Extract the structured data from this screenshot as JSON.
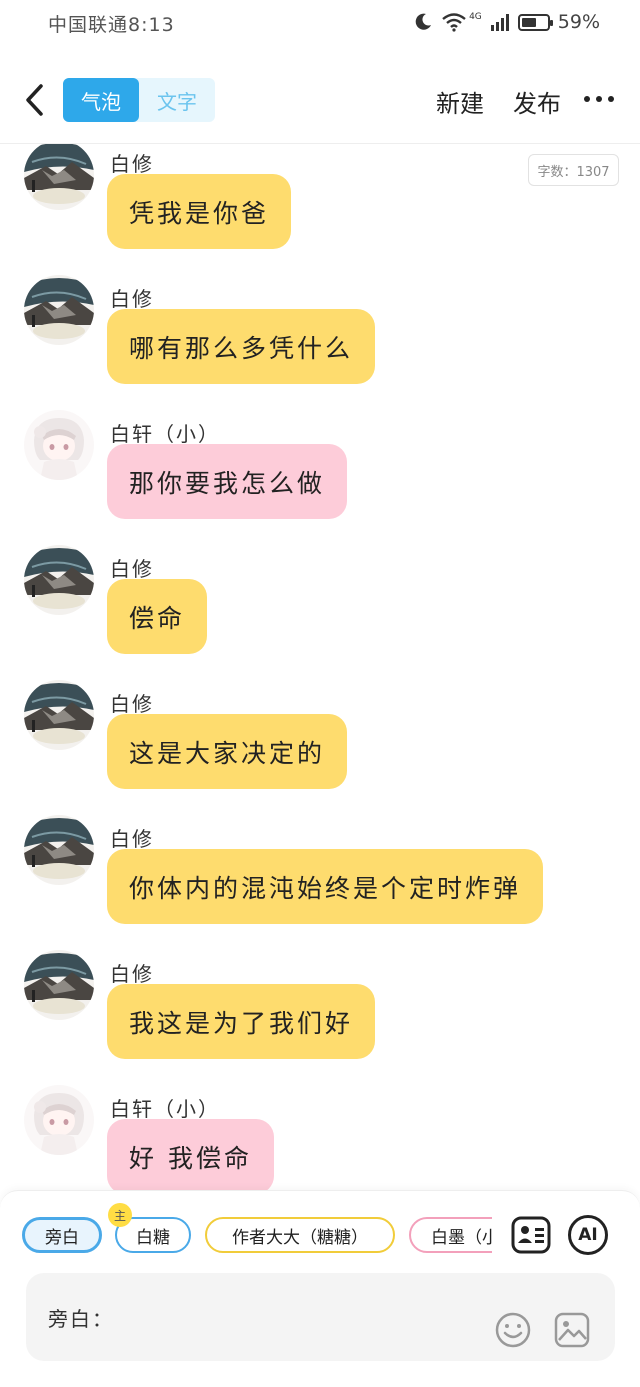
{
  "status_bar": {
    "carrier_time": "中国联通8:13",
    "battery": "59%",
    "battery_level": 0.59,
    "network": "4G"
  },
  "header": {
    "tabs": [
      {
        "label": "气泡",
        "active": true
      },
      {
        "label": "文字",
        "active": false
      }
    ],
    "new_label": "新建",
    "publish_label": "发布"
  },
  "chat": {
    "word_count": "字数：1307",
    "messages": [
      {
        "sender": "白修",
        "text": "凭我是你爸",
        "color": "yellow",
        "avatar": "landscape-avatar"
      },
      {
        "sender": "白修",
        "text": "哪有那么多凭什么",
        "color": "yellow",
        "avatar": "landscape-avatar"
      },
      {
        "sender": "白轩（小）",
        "text": "那你要我怎么做",
        "color": "pink",
        "avatar": "anime-girl-avatar"
      },
      {
        "sender": "白修",
        "text": "偿命",
        "color": "yellow",
        "avatar": "landscape-avatar"
      },
      {
        "sender": "白修",
        "text": "这是大家决定的",
        "color": "yellow",
        "avatar": "landscape-avatar"
      },
      {
        "sender": "白修",
        "text": "你体内的混沌始终是个定时炸弹",
        "color": "yellow",
        "avatar": "landscape-avatar"
      },
      {
        "sender": "白修",
        "text": "我这是为了我们好",
        "color": "yellow",
        "avatar": "landscape-avatar"
      },
      {
        "sender": "白轩（小）",
        "text": "好 我偿命",
        "color": "pink",
        "avatar": "anime-girl-avatar"
      }
    ]
  },
  "bottom": {
    "roles": [
      "旁白",
      "白糖",
      "作者大大（糖糖）",
      "白墨（小"
    ],
    "host_badge": "主",
    "ai_label": "AI",
    "input_label": "旁白："
  },
  "colors": {
    "accent": "#2ea8ea",
    "bubble_yellow": "#fedc6e",
    "bubble_pink": "#fdccd9"
  }
}
